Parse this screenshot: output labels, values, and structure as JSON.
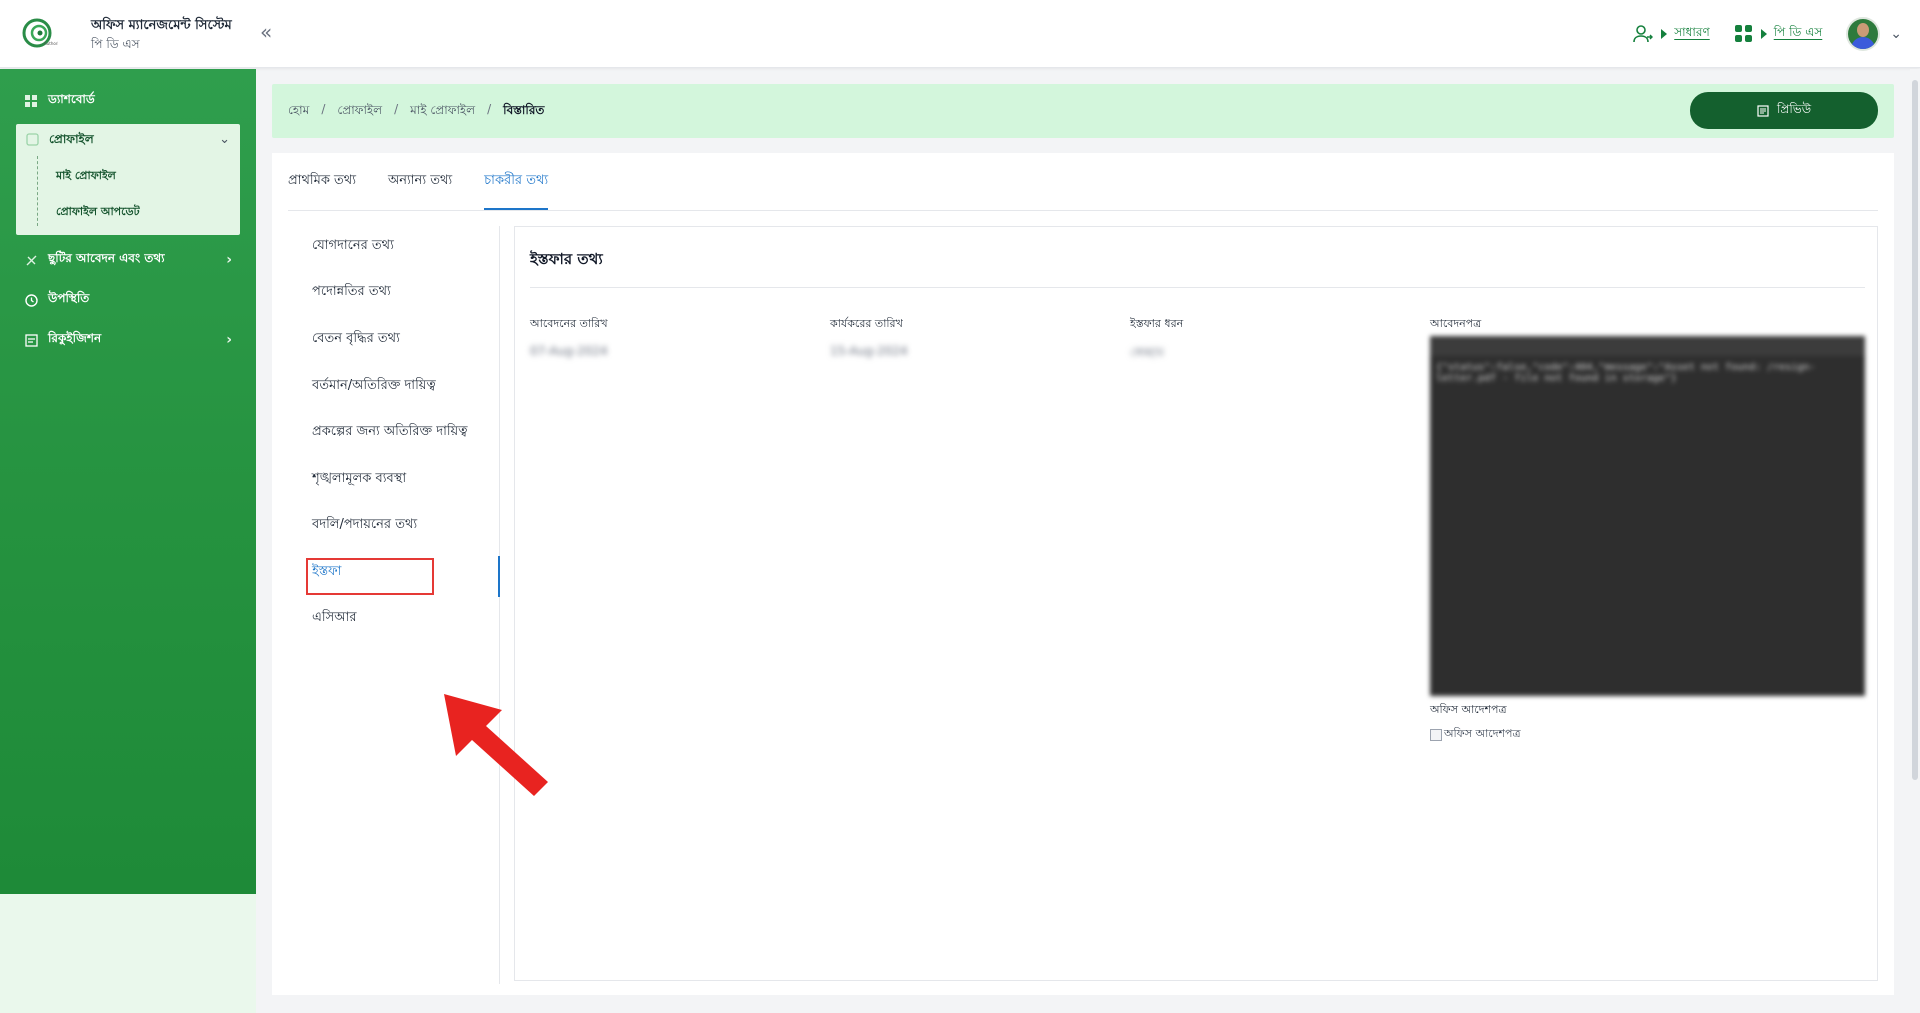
{
  "app": {
    "title": "অফিস ম্যানেজমেন্ট সিস্টেম",
    "subtitle": "পি ডি এস",
    "collapse_icon": "double-chevron-left-icon"
  },
  "topbar": {
    "role_link": "সাধারণ",
    "module_link": "পি ডি এস",
    "accent": "#15803d"
  },
  "sidebar": {
    "dashboard": "ড্যাশবোর্ড",
    "profile": "প্রোফাইল",
    "profile_children": [
      "মাই প্রোফাইল",
      "প্রোফাইল আপডেট"
    ],
    "leave": "ছুটির আবেদন এবং তথ্য",
    "attendance": "উপস্থিতি",
    "requisition": "রিকুইজিশন"
  },
  "breadcrumb": {
    "items": [
      "হোম",
      "প্রোফাইল",
      "মাই প্রোফাইল"
    ],
    "current": "বিস্তারিত",
    "separator": "/"
  },
  "preview_button": "প্রিভিউ",
  "tabs": [
    "প্রাথমিক তথ্য",
    "অন্যান্য তথ্য",
    "চাকরীর তথ্য"
  ],
  "submenu": [
    "যোগদানের তথ্য",
    "পদোন্নতির তথ্য",
    "বেতন বৃদ্ধির তথ্য",
    "বর্তমান/অতিরিক্ত দায়িত্ব",
    "প্রকল্পের জন্য অতিরিক্ত দায়িত্ব",
    "শৃঙ্খলামূলক ব্যবস্থা",
    "বদলি/পদায়নের তথ্য",
    "ইস্তফা",
    "এসিআর"
  ],
  "resignation": {
    "heading": "ইস্তফার তথ্য",
    "application_date_label": "আবেদনের তারিখ",
    "application_date": "07-Aug-2024",
    "effective_date_label": "কার্যকরের তারিখ",
    "effective_date": "15-Aug-2024",
    "type_label": "ইস্তফার ধরন",
    "type": "স্বেচ্ছায়",
    "application_doc_label": "আবেদনপত্র",
    "application_doc_text": "{\"status\":false,\"code\":404,\"message\":\"Asset not found: /resign-letter.pdf - file not found in storage\"}",
    "office_order_label": "অফিস আদেশপত্র",
    "office_order_alt": "অফিস আদেশপত্র"
  }
}
